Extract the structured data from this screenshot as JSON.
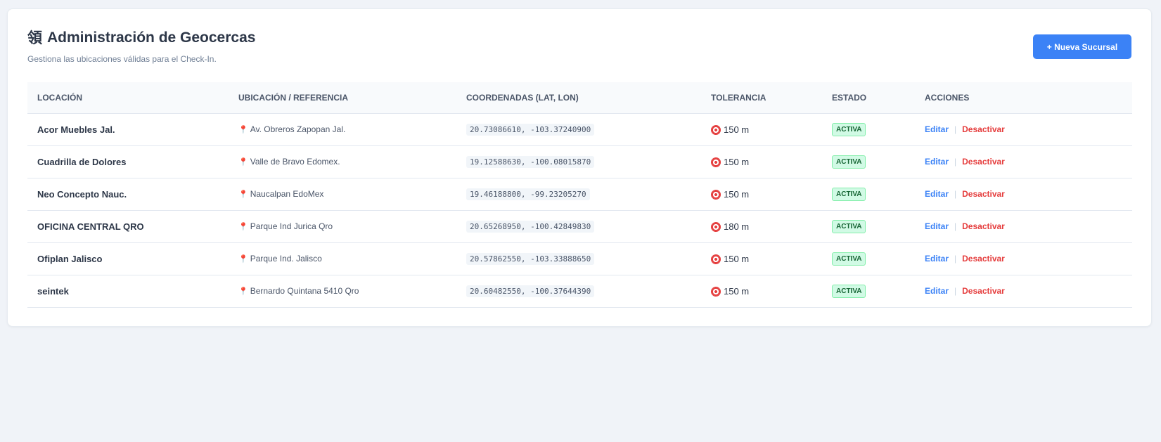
{
  "header": {
    "icon": "map-region-icon",
    "icon_glyph": "領",
    "title": "Administración de Geocercas",
    "subtitle": "Gestiona las ubicaciones válidas para el Check-In.",
    "new_button_label": "+ Nueva Sucursal"
  },
  "table": {
    "columns": [
      "Locación",
      "Ubicación / Referencia",
      "Coordenadas (Lat, Lon)",
      "Tolerancia",
      "Estado",
      "Acciones"
    ],
    "rows": [
      {
        "locacion": "Acor Muebles Jal.",
        "referencia": "Av. Obreros Zapopan Jal.",
        "coords": "20.73086610, -103.37240900",
        "tolerancia": "150 m",
        "estado": "ACTIVA",
        "edit": "Editar",
        "deactivate": "Desactivar"
      },
      {
        "locacion": "Cuadrilla de Dolores",
        "referencia": "Valle de Bravo Edomex.",
        "coords": "19.12588630, -100.08015870",
        "tolerancia": "150 m",
        "estado": "ACTIVA",
        "edit": "Editar",
        "deactivate": "Desactivar"
      },
      {
        "locacion": "Neo Concepto Nauc.",
        "referencia": "Naucalpan EdoMex",
        "coords": "19.46188800, -99.23205270",
        "tolerancia": "150 m",
        "estado": "ACTIVA",
        "edit": "Editar",
        "deactivate": "Desactivar"
      },
      {
        "locacion": "OFICINA CENTRAL QRO",
        "referencia": "Parque Ind Jurica Qro",
        "coords": "20.65268950, -100.42849830",
        "tolerancia": "180 m",
        "estado": "ACTIVA",
        "edit": "Editar",
        "deactivate": "Desactivar"
      },
      {
        "locacion": "Ofiplan Jalisco",
        "referencia": "Parque Ind. Jalisco",
        "coords": "20.57862550, -103.33888650",
        "tolerancia": "150 m",
        "estado": "ACTIVA",
        "edit": "Editar",
        "deactivate": "Desactivar"
      },
      {
        "locacion": "seintek",
        "referencia": "Bernardo Quintana 5410 Qro",
        "coords": "20.60482550, -100.37644390",
        "tolerancia": "150 m",
        "estado": "ACTIVA",
        "edit": "Editar",
        "deactivate": "Desactivar"
      }
    ]
  },
  "colors": {
    "accent": "#3b82f6",
    "danger": "#e53e3e",
    "badge_bg": "#d1fae5",
    "badge_text": "#166534",
    "page_bg": "#f0f3f8"
  }
}
